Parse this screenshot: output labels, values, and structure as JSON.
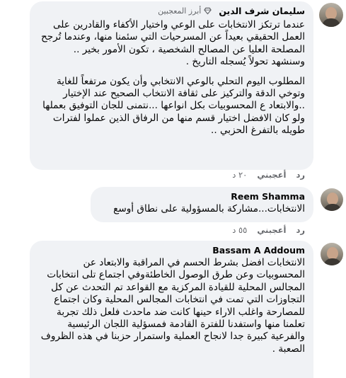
{
  "comments": [
    {
      "author": "سليمان شرف الدين",
      "badge": "أبرز المعجبين",
      "badge_icon": "diamond-icon",
      "paragraphs": [
        "عندما ترتكز الانتخابات على الوعي واختيار الأكفاء والقادرين على العمل الحقيقي بعيداً عن المسرحيات التي سئمنا منها، وعندما تُرجح المصلحة العليا عن المصالح الشخصية ، تكون الأمور بخير .. وسنشهد تحولاً يُسجله التاريخ .",
        "المطلوب اليوم التحلي بالوعي الانتخابي وأن يكون مرتفعاً للغاية وتوخي الدقة والتركيز على ثقافة الانتخاب الصحيح عند الإختيار ..والابتعاد ع المحسوبيات بكل انواعها ...نتمنى للجان التوفيق بعملها ولو كان الافضل اختيار قسم منها من الرفاق الذين عملوا لفترات طويله بالتفرغ الحزبي .."
      ],
      "time": "٢٠ د",
      "like": "أعجبني",
      "reply": "رد"
    },
    {
      "author": "Reem Shamma",
      "paragraphs": [
        "الانتخابات...مشاركة بالمسؤولية على نطاق أوسع"
      ],
      "time": "٥٥ د",
      "like": "أعجبني",
      "reply": "رد"
    },
    {
      "author": "Bassam A Addoum",
      "paragraphs": [
        "الانتخابات افضل بشرط الحسم في المراقبة والابتعاد عن المحسوبيات وعن طرق الوصول الخاطئةوفي اجتماع تلى انتخابات المجالس المحلية للقيادة المركزية مع القواعد تم التحدث عن كل التجاوزات التي تمت في انتخابات المجالس المحلية وكان اجتماع للمصارحة واغلب الاراء حينها كانت ضد ماحدث فلعل ذلك تجربة تعلمنا منها واستفدنا للفترة القادمة فمسؤلية اللجان الرئيسية والفرعية كبيرة جدا لانجاح العملية واستمرار حزبنا في هذه الظروف الصعبة ."
      ]
    }
  ],
  "colors": {
    "bubble": "#f0f2f5",
    "text": "#050505",
    "secondary": "#65676b"
  }
}
